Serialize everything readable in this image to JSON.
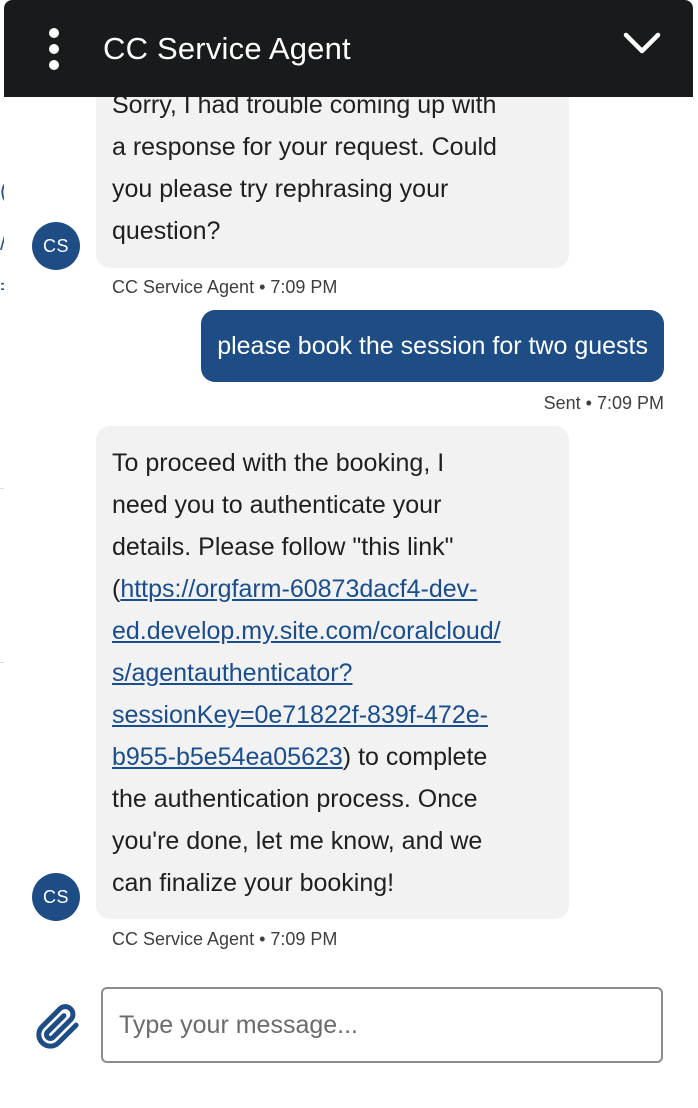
{
  "header": {
    "title": "CC Service Agent",
    "menu_icon": "more-vertical-icon",
    "minimize_icon": "chevron-down-icon",
    "background": "#191a1b"
  },
  "messages": [
    {
      "type": "agent",
      "avatar": "CS",
      "lines": [
        "Sorry, I had trouble coming up with",
        "a response for your request. Could",
        "you please try rephrasing your",
        "question?"
      ],
      "meta": "CC Service Agent • 7:09 PM"
    },
    {
      "type": "user",
      "text": "please book the session for two guests",
      "meta": "Sent • 7:09 PM"
    },
    {
      "type": "agent",
      "avatar": "CS",
      "lines": [
        "To proceed with the booking, I",
        "need you to authenticate your",
        "details. Please follow \"this link\""
      ],
      "link_open": "(",
      "link_lines": [
        "https://orgfarm-60873dacf4-dev-",
        "ed.develop.my.site.com/coralcloud/",
        "s/agentauthenticator?",
        "sessionKey=0e71822f-839f-472e-",
        "b955-b5e54ea05623"
      ],
      "link_close": ") to complete",
      "tail_lines": [
        "the authentication process. Once",
        "you're done, let me know, and we",
        "can finalize your booking!"
      ],
      "meta": "CC Service Agent • 7:09 PM"
    }
  ],
  "composer": {
    "placeholder": "Type your message...",
    "value": "",
    "attach_icon": "paperclip-icon"
  },
  "colors": {
    "agent_bubble": "#f2f2f2",
    "user_bubble": "#1e4d85",
    "avatar": "#1e4d85",
    "link": "#1a4d8c"
  }
}
